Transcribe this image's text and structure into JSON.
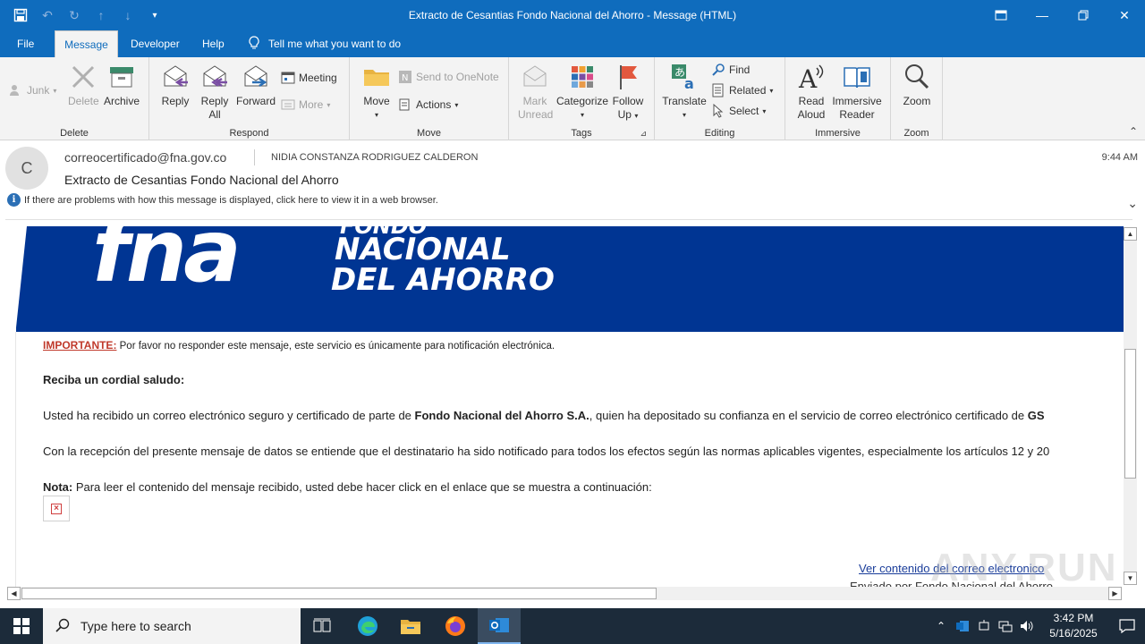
{
  "window": {
    "title": "Extracto de Cesantias Fondo Nacional del Ahorro  -  Message (HTML)"
  },
  "tabs": [
    "File",
    "Message",
    "Developer",
    "Help"
  ],
  "tellme": "Tell me what you want to do",
  "ribbon": {
    "delete_group": {
      "label": "Delete",
      "junk": "Junk",
      "delete": "Delete",
      "archive": "Archive"
    },
    "respond_group": {
      "label": "Respond",
      "reply": "Reply",
      "reply_all_1": "Reply",
      "reply_all_2": "All",
      "forward": "Forward",
      "meeting": "Meeting",
      "more": "More"
    },
    "move_group": {
      "label": "Move",
      "move": "Move",
      "onenote": "Send to OneNote",
      "actions": "Actions"
    },
    "tags_group": {
      "label": "Tags",
      "mark_unread_1": "Mark",
      "mark_unread_2": "Unread",
      "categorize": "Categorize",
      "follow_up_1": "Follow",
      "follow_up_2": "Up"
    },
    "editing_group": {
      "label": "Editing",
      "translate": "Translate",
      "find": "Find",
      "related": "Related",
      "select": "Select"
    },
    "immersive_group": {
      "label": "Immersive",
      "read_aloud_1": "Read",
      "read_aloud_2": "Aloud",
      "immersive_reader_1": "Immersive",
      "immersive_reader_2": "Reader"
    },
    "zoom_group": {
      "label": "Zoom",
      "zoom": "Zoom"
    }
  },
  "message": {
    "avatar_initial": "C",
    "from": "correocertificado@fna.gov.co",
    "to": "NIDIA CONSTANZA RODRIGUEZ CALDERON",
    "time": "9:44 AM",
    "subject": "Extracto de Cesantias Fondo Nacional del Ahorro",
    "infobar": "If there are problems with how this message is displayed, click here to view it in a web browser."
  },
  "body": {
    "banner_logo": "fna",
    "banner_line0": "FONDO",
    "banner_line1": "NACIONAL",
    "banner_line2": "DEL AHORRO",
    "important_label": "IMPORTANTE:",
    "important_text": " Por favor no responder este mensaje, este servicio es únicamente para notificación electrónica.",
    "greeting": "Reciba un cordial saludo:",
    "p1_a": "Usted ha recibido un correo electrónico seguro y certificado de parte de ",
    "p1_b": "Fondo Nacional del Ahorro S.A.",
    "p1_c": ", quien ha depositado su confianza en el servicio de correo electrónico certificado de ",
    "p1_d": "GS",
    "p2": "Con la recepción del presente mensaje de datos se entiende que el destinatario ha sido notificado para todos los efectos según las normas aplicables vigentes, especialmente los artículos 12 y 20",
    "nota_label": "Nota:",
    "nota_text": " Para leer el contenido del mensaje recibido, usted debe hacer click en el enlace que se muestra a continuación:",
    "link": "Ver contenido del correo electronico",
    "sent_by": "Enviado por Fondo Nacional del Ahorro"
  },
  "watermark": "ANY.RUN",
  "taskbar": {
    "search_placeholder": "Type here to search",
    "time": "3:42 PM",
    "date": "5/16/2025"
  }
}
